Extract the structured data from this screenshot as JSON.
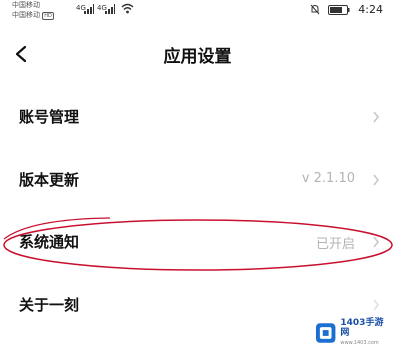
{
  "status_bar": {
    "carrier_1": "中国移动",
    "carrier_2": "中国移动",
    "hd_badge": "HD",
    "network_1": "4G",
    "network_2": "4G",
    "time": "4:24"
  },
  "header": {
    "title": "应用设置",
    "back_icon": "chevron-left-icon"
  },
  "settings": [
    {
      "label": "账号管理",
      "value": ""
    },
    {
      "label": "版本更新",
      "value": "v 2.1.10"
    },
    {
      "label": "系统通知",
      "value": "已开启"
    },
    {
      "label": "关于一刻",
      "value": ""
    }
  ],
  "annotation": {
    "color": "#c8102e"
  },
  "watermark": {
    "text": "1403手游网",
    "sub": "www.1403.com"
  }
}
